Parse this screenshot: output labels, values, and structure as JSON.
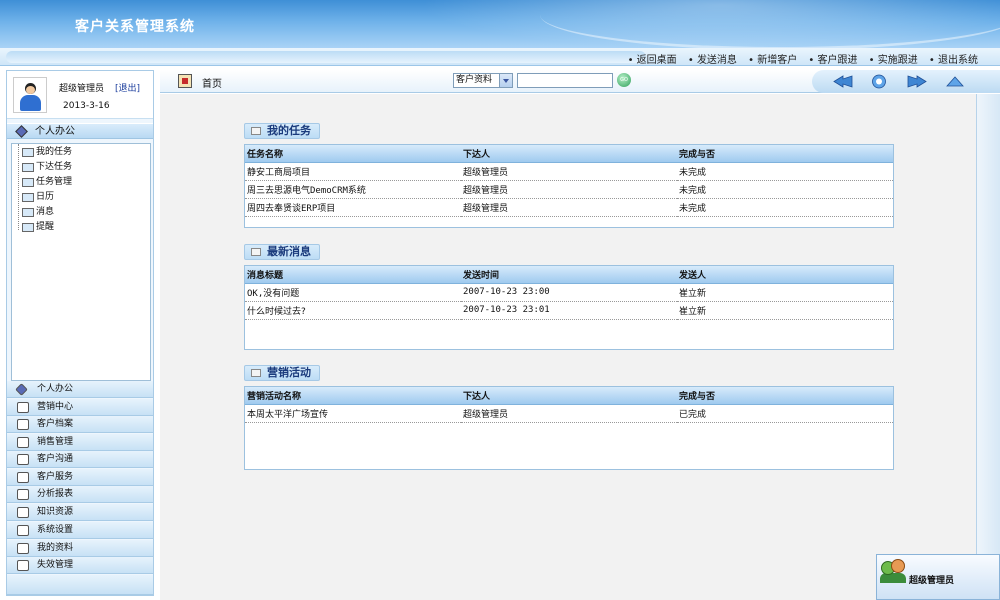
{
  "app": {
    "title": "客户关系管理系统"
  },
  "topnav": {
    "links": [
      "返回桌面",
      "发送消息",
      "新增客户",
      "客户跟进",
      "实施跟进",
      "退出系统"
    ]
  },
  "user": {
    "name": "超级管理员",
    "logout_label": "[退出]",
    "date": "2013-3-16"
  },
  "sidebar": {
    "section_label": "个人办公",
    "tree_items": [
      "我的任务",
      "下达任务",
      "任务管理",
      "日历",
      "消息",
      "提醒"
    ],
    "menu_items": [
      "个人办公",
      "营销中心",
      "客户档案",
      "销售管理",
      "客户沟通",
      "客户服务",
      "分析报表",
      "知识资源",
      "系统设置",
      "我的资料",
      "失效管理"
    ]
  },
  "toolbar": {
    "home_label": "首页",
    "search_select": "客户资料",
    "search_value": "",
    "go_label": "GO"
  },
  "tasks": {
    "title": "我的任务",
    "headers": [
      "任务名称",
      "下达人",
      "完成与否"
    ],
    "rows": [
      [
        "静安工商局项目",
        "超级管理员",
        "未完成"
      ],
      [
        "周三去思源电气DemoCRM系统",
        "超级管理员",
        "未完成"
      ],
      [
        "周四去奉贤谈ERP项目",
        "超级管理员",
        "未完成"
      ]
    ]
  },
  "messages": {
    "title": "最新消息",
    "headers": [
      "消息标题",
      "发送时间",
      "发送人"
    ],
    "rows": [
      [
        "OK,没有问题",
        "2007-10-23 23:00",
        "崔立新"
      ],
      [
        "什么时候过去?",
        "2007-10-23 23:01",
        "崔立新"
      ]
    ]
  },
  "marketing": {
    "title": "营销活动",
    "headers": [
      "营销活动名称",
      "下达人",
      "完成与否"
    ],
    "rows": [
      [
        "本周太平洋广场宣传",
        "超级管理员",
        "已完成"
      ]
    ]
  },
  "usercard": {
    "name": "超级管理员"
  },
  "colors": {
    "header_blue": "#3f8fd6",
    "panel_border": "#9cc1df",
    "title_blue": "#1a3a7c"
  }
}
